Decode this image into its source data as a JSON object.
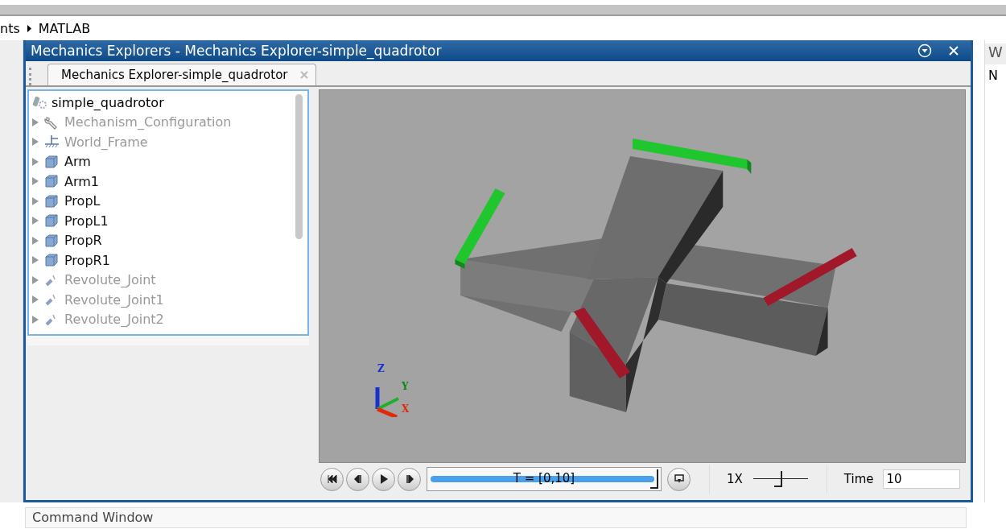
{
  "breadcrumb": [
    "nts",
    "MATLAB"
  ],
  "window": {
    "title": "Mechanics Explorers - Mechanics Explorer-simple_quadrotor"
  },
  "tabs": [
    {
      "label": "Mechanics Explorer-simple_quadrotor",
      "selected": true
    }
  ],
  "tree": {
    "root": "simple_quadrotor",
    "items": [
      {
        "label": "Mechanism_Configuration",
        "kind": "config",
        "disabled": true
      },
      {
        "label": "World_Frame",
        "kind": "frame",
        "disabled": true
      },
      {
        "label": "Arm",
        "kind": "body",
        "disabled": false
      },
      {
        "label": "Arm1",
        "kind": "body",
        "disabled": false
      },
      {
        "label": "PropL",
        "kind": "body",
        "disabled": false
      },
      {
        "label": "PropL1",
        "kind": "body",
        "disabled": false
      },
      {
        "label": "PropR",
        "kind": "body",
        "disabled": false
      },
      {
        "label": "PropR1",
        "kind": "body",
        "disabled": false
      },
      {
        "label": "Revolute_Joint",
        "kind": "joint",
        "disabled": true
      },
      {
        "label": "Revolute_Joint1",
        "kind": "joint",
        "disabled": true
      },
      {
        "label": "Revolute_Joint2",
        "kind": "joint",
        "disabled": true
      }
    ]
  },
  "axes": {
    "z": "Z",
    "y": "Y",
    "x": "X"
  },
  "playback": {
    "range": "T = [0,10]",
    "level": 1,
    "speed_label": "1X",
    "speed": {
      "level": 0.45
    },
    "time_label": "Time",
    "time_value": "10"
  },
  "right_panel": {
    "title": "W",
    "row": "N"
  },
  "command_window": {
    "title": "Command Window"
  }
}
